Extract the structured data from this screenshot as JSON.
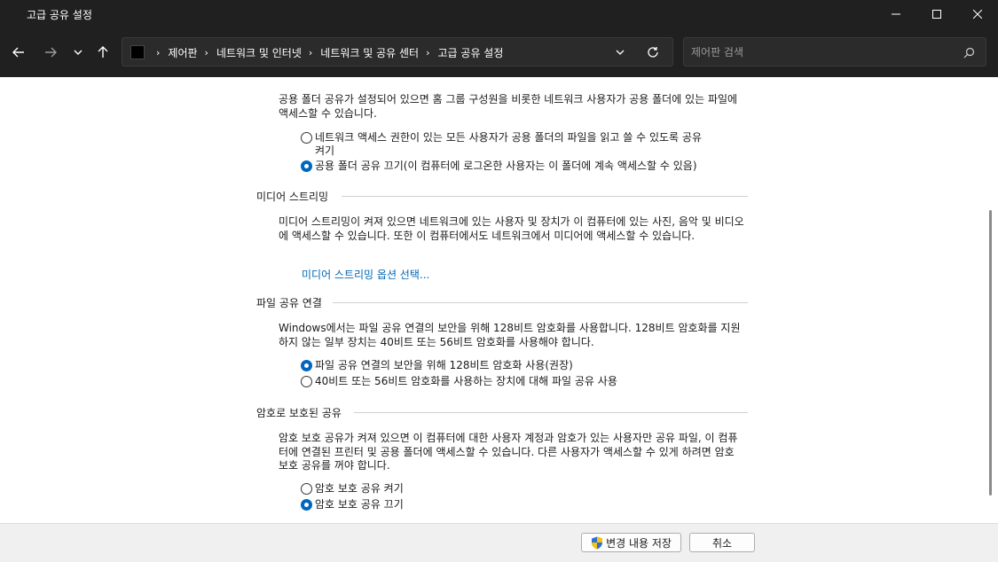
{
  "window": {
    "title": "고급 공유 설정"
  },
  "address_bar": {
    "breadcrumbs": [
      "제어판",
      "네트워크 및 인터넷",
      "네트워크 및 공유 센터",
      "고급 공유 설정"
    ]
  },
  "search": {
    "placeholder": "제어판 검색"
  },
  "sections": {
    "public_folder": {
      "description": "공용 폴더 공유가 설정되어 있으면 홈 그룹 구성원을 비롯한 네트워크 사용자가 공용 폴더에 있는 파일에 액세스할 수 있습니다.",
      "option_on_line1": "네트워크 액세스 권한이 있는 모든 사용자가 공용 폴더의 파일을 읽고 쓸 수 있도록 공유",
      "option_on_line2": "켜기",
      "option_off": "공용 폴더 공유 끄기(이 컴퓨터에 로그온한 사용자는 이 폴더에 계속 액세스할 수 있음)",
      "selected": "off"
    },
    "media_streaming": {
      "title": "미디어 스트리밍",
      "description": "미디어 스트리밍이 켜져 있으면 네트워크에 있는 사용자 및 장치가 이 컴퓨터에 있는 사진, 음악 및 비디오에 액세스할 수 있습니다. 또한 이 컴퓨터에서도 네트워크에서 미디어에 액세스할 수 있습니다.",
      "link": "미디어 스트리밍 옵션 선택..."
    },
    "file_sharing": {
      "title": "파일 공유 연결",
      "description": "Windows에서는 파일 공유 연결의 보안을 위해 128비트 암호화를 사용합니다. 128비트 암호화를 지원하지 않는 일부 장치는 40비트 또는 56비트 암호화를 사용해야 합니다.",
      "option_128": "파일 공유 연결의 보안을 위해 128비트 암호화 사용(권장)",
      "option_40_56": "40비트 또는 56비트 암호화를 사용하는 장치에 대해 파일 공유 사용",
      "selected": "128"
    },
    "password_protected": {
      "title": "암호로 보호된 공유",
      "description": "암호 보호 공유가 켜져 있으면 이 컴퓨터에 대한 사용자 계정과 암호가 있는 사용자만 공유 파일, 이 컴퓨터에 연결된 프린터 및 공용 폴더에 액세스할 수 있습니다. 다른 사용자가 액세스할 수 있게 하려면 암호 보호 공유를 꺼야 합니다.",
      "option_on": "암호 보호 공유 켜기",
      "option_off": "암호 보호 공유 끄기",
      "selected": "off"
    }
  },
  "footer": {
    "save_label": "변경 내용 저장",
    "cancel_label": "취소"
  },
  "colors": {
    "accent": "#0067c0",
    "link": "#0066b4",
    "chrome": "#202020"
  }
}
